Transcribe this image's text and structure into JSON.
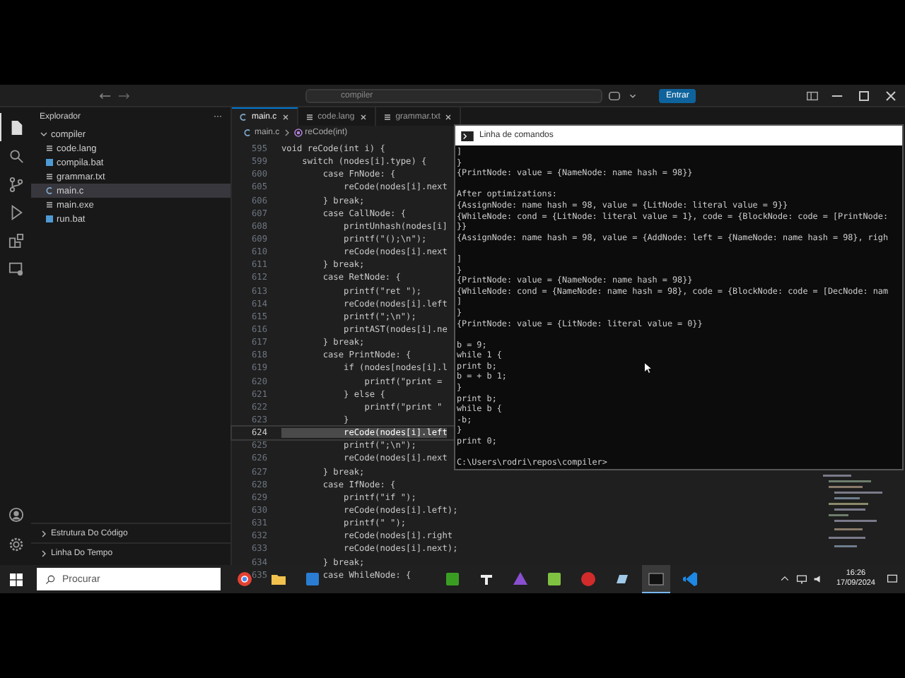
{
  "title_bar": {
    "search": "compiler",
    "sign_in_button": "Entrar"
  },
  "activity_bar": [
    {
      "kind": "files",
      "selected": true
    },
    {
      "kind": "search",
      "selected": false
    },
    {
      "kind": "branch",
      "selected": false
    },
    {
      "kind": "run",
      "selected": false
    },
    {
      "kind": "blocks",
      "selected": false
    },
    {
      "kind": "monitor",
      "selected": false
    }
  ],
  "sidebar": {
    "title": "Explorador",
    "menu": "···",
    "folder": {
      "name": "compiler",
      "expanded": true,
      "children": [
        {
          "name": "code.lang",
          "kind": "text",
          "selected": false
        },
        {
          "name": "compila.bat",
          "kind": "bat",
          "selected": false
        },
        {
          "name": "grammar.txt",
          "kind": "text",
          "selected": false
        },
        {
          "name": "main.c",
          "kind": "c",
          "selected": true
        },
        {
          "name": "main.exe",
          "kind": "text",
          "selected": false
        },
        {
          "name": "run.bat",
          "kind": "bat",
          "selected": false
        }
      ]
    },
    "sections": [
      {
        "name": "Estrutura Do Código",
        "expanded": false
      },
      {
        "name": "Linha Do Tempo",
        "expanded": false
      }
    ]
  },
  "editor": {
    "tabs": [
      {
        "label": "main.c",
        "kind": "c",
        "selected": true
      },
      {
        "label": "code.lang",
        "kind": "text",
        "selected": false
      },
      {
        "label": "grammar.txt",
        "kind": "text",
        "selected": false
      }
    ],
    "breadcrumb": [
      "main.c",
      "reCode(int)"
    ],
    "lines": [
      {
        "n": "595",
        "code": "void reCode(int i) {",
        "current": false
      },
      {
        "n": "599",
        "code": "    switch (nodes[i].type) {",
        "current": false
      },
      {
        "n": "600",
        "code": "        case FnNode: {",
        "current": false
      },
      {
        "n": "605",
        "code": "            reCode(nodes[i].next",
        "current": false
      },
      {
        "n": "606",
        "code": "        } break;",
        "current": false
      },
      {
        "n": "607",
        "code": "        case CallNode: {",
        "current": false
      },
      {
        "n": "608",
        "code": "            printUnhash(nodes[i]",
        "current": false
      },
      {
        "n": "609",
        "code": "            printf(\"();\\n\");",
        "current": false
      },
      {
        "n": "610",
        "code": "            reCode(nodes[i].next",
        "current": false
      },
      {
        "n": "611",
        "code": "        } break;",
        "current": false
      },
      {
        "n": "612",
        "code": "        case RetNode: {",
        "current": false
      },
      {
        "n": "613",
        "code": "            printf(\"ret \");",
        "current": false
      },
      {
        "n": "614",
        "code": "            reCode(nodes[i].left",
        "current": false
      },
      {
        "n": "615",
        "code": "            printf(\";\\n\");",
        "current": false
      },
      {
        "n": "616",
        "code": "            printAST(nodes[i].ne",
        "current": false
      },
      {
        "n": "617",
        "code": "        } break;",
        "current": false
      },
      {
        "n": "618",
        "code": "        case PrintNode: {",
        "current": false
      },
      {
        "n": "619",
        "code": "            if (nodes[nodes[i].l",
        "current": false
      },
      {
        "n": "620",
        "code": "                printf(\"print = ",
        "current": false
      },
      {
        "n": "621",
        "code": "            } else {",
        "current": false
      },
      {
        "n": "622",
        "code": "                printf(\"print \"",
        "current": false
      },
      {
        "n": "623",
        "code": "            }",
        "current": false
      },
      {
        "n": "624",
        "code": "            reCode(nodes[i].left",
        "current": true
      },
      {
        "n": "625",
        "code": "            printf(\";\\n\");",
        "current": false
      },
      {
        "n": "626",
        "code": "            reCode(nodes[i].next",
        "current": false
      },
      {
        "n": "627",
        "code": "        } break;",
        "current": false
      },
      {
        "n": "628",
        "code": "        case IfNode: {",
        "current": false
      },
      {
        "n": "629",
        "code": "            printf(\"if \");",
        "current": false
      },
      {
        "n": "630",
        "code": "            reCode(nodes[i].left);",
        "current": false
      },
      {
        "n": "631",
        "code": "            printf(\" \");",
        "current": false
      },
      {
        "n": "632",
        "code": "            reCode(nodes[i].right",
        "current": false
      },
      {
        "n": "633",
        "code": "            reCode(nodes[i].next);",
        "current": false
      },
      {
        "n": "634",
        "code": "        } break;",
        "current": false
      },
      {
        "n": "635",
        "code": "        case WhileNode: {",
        "current": false
      }
    ]
  },
  "terminal": {
    "title": "Linha de comandos",
    "blocks": [
      [
        "]",
        "}",
        "{PrintNode: value = {NameNode: name hash = 98}}"
      ],
      [
        "After optimizations:",
        "{AssignNode: name hash = 98, value = {LitNode: literal value = 9}}",
        "{WhileNode: cond = {LitNode: literal value = 1}, code = {BlockNode: code = [PrintNode:",
        "}}",
        "{AssignNode: name hash = 98, value = {AddNode: left = {NameNode: name hash = 98}, righ"
      ],
      [
        "]",
        "}",
        "{PrintNode: value = {NameNode: name hash = 98}}",
        "{WhileNode: cond = {NameNode: name hash = 98}, code = {BlockNode: code = [DecNode: nam",
        "]",
        "}",
        "{PrintNode: value = {LitNode: literal value = 0}}"
      ],
      [
        "b = 9;",
        "while 1 {",
        "print b;",
        "b = + b 1;",
        "}",
        "print b;",
        "while b {",
        "-b;",
        "}",
        "print 0;"
      ],
      [
        "C:\\Users\\rodri\\repos\\compiler>"
      ]
    ]
  },
  "taskbar": {
    "search": {
      "placeholder": "Procurar"
    },
    "apps": [
      {
        "kind": "chrome",
        "selected": false
      },
      {
        "kind": "folder",
        "selected": false
      },
      {
        "kind": "store",
        "selected": false
      },
      {
        "kind": "green",
        "selected": false
      },
      {
        "kind": "dark",
        "selected": false
      },
      {
        "kind": "triangles",
        "selected": false
      },
      {
        "kind": "notes",
        "selected": false
      },
      {
        "kind": "red",
        "selected": false
      },
      {
        "kind": "cloud",
        "selected": false
      },
      {
        "kind": "terminal",
        "selected": true
      },
      {
        "kind": "code",
        "selected": false
      }
    ],
    "time": "16:26",
    "date": "17/09/2024"
  }
}
